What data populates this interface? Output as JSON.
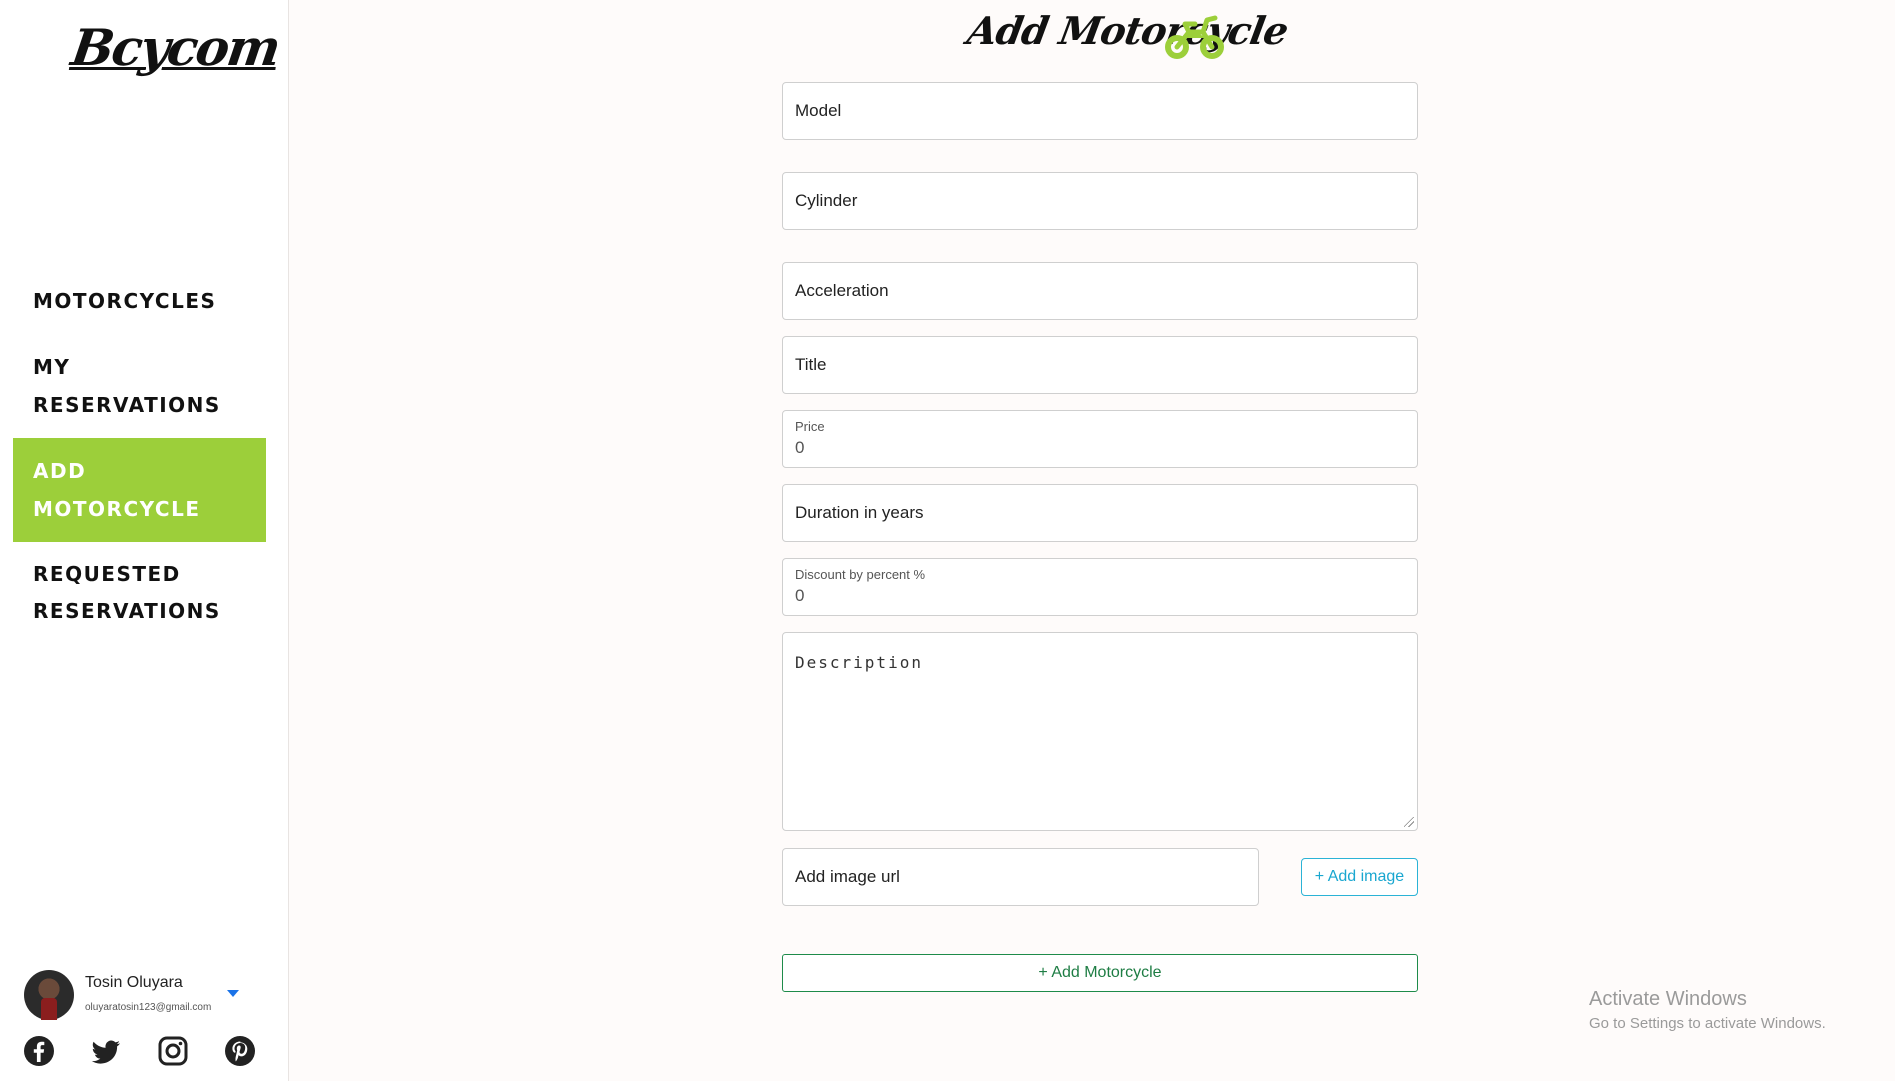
{
  "sidebar": {
    "logo": "Bcycom",
    "nav": [
      {
        "label": "MOTORCYCLES"
      },
      {
        "label": "MY RESERVATIONS"
      },
      {
        "label": "ADD MOTORCYCLE",
        "active": true
      },
      {
        "label": "REQUESTED RESERVATIONS"
      }
    ],
    "user": {
      "name": "Tosin Oluyara",
      "email": "oluyaratosin123@gmail.com"
    },
    "social_icons": [
      "facebook-icon",
      "twitter-icon",
      "instagram-icon",
      "pinterest-icon"
    ]
  },
  "main": {
    "title": "Add Motorcycle",
    "form": {
      "model_placeholder": "Model",
      "cylinder_placeholder": "Cylinder",
      "acceleration_placeholder": "Acceleration",
      "title_placeholder": "Title",
      "price_label": "Price",
      "price_value": "0",
      "duration_placeholder": "Duration in years",
      "discount_label": "Discount by percent %",
      "discount_value": "0",
      "description_placeholder": "Description",
      "image_url_placeholder": "Add image url",
      "add_image_label": "+ Add image",
      "submit_label": "+ Add Motorcycle"
    }
  },
  "watermark": {
    "line1": "Activate Windows",
    "line2": "Go to Settings to activate Windows."
  },
  "colors": {
    "accent": "#9ccf3a",
    "add_image_border": "#2bb3d6",
    "submit_border": "#1e8b4a"
  }
}
